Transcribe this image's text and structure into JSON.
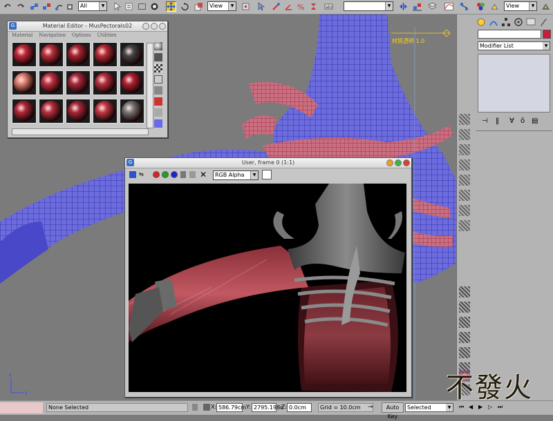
{
  "toolbar": {
    "selection_filter": "All",
    "ref_coord": "View",
    "named_selection": "",
    "ref_coord_right": "View"
  },
  "viewport": {
    "label": "材質透明 1.0"
  },
  "material_editor": {
    "title": "Material Editor - MusPectorals02",
    "menu": [
      "Material",
      "Navigation",
      "Options",
      "Utilities"
    ]
  },
  "render_window": {
    "title": "User, frame 0 (1:1)",
    "channel": "RGB Alpha"
  },
  "command_panel": {
    "name_field": "",
    "modifier_list": "Modifier List"
  },
  "statusbar": {
    "selection": "None Selected",
    "x_label": "X:",
    "x_value": "586.79cm",
    "y_label": "Y:",
    "y_value": "2795.198c",
    "z_label": "Z:",
    "z_value": "0.0cm",
    "grid": "Grid = 10.0cm",
    "auto_key": "Auto Key",
    "key_mode": "Selected"
  },
  "watermark": "不發火",
  "colors": {
    "toolbar_bg": "#b7b7b7",
    "viewport_bg": "#7b7b7b",
    "wire_blue": "#2d2de6",
    "wire_red": "#c8325a",
    "highlight_yellow": "#ffd21a"
  }
}
